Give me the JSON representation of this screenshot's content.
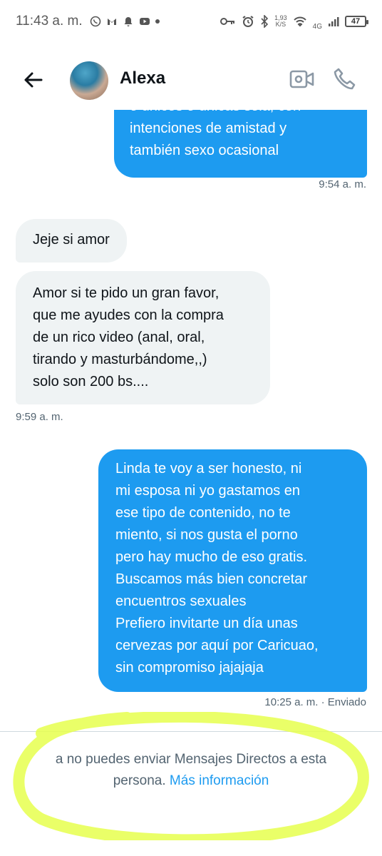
{
  "status_bar": {
    "time": "11:43 a. m.",
    "net_speed_value": "1,93",
    "net_speed_unit": "K/S",
    "network": "4G",
    "battery": "47"
  },
  "header": {
    "contact_name": "Alexa"
  },
  "messages": [
    {
      "direction": "outgoing",
      "lines": [
        "o únicos o únicas sola, con",
        "intenciones de amistad y",
        "también sexo ocasional"
      ]
    },
    {
      "direction": "outgoing-meta",
      "time": "9:54 a. m."
    },
    {
      "direction": "incoming",
      "lines": [
        "Jeje si amor"
      ]
    },
    {
      "direction": "incoming",
      "lines": [
        "Amor si te pido un gran favor,",
        "que me ayudes con la compra",
        "de un rico video (anal, oral,",
        "tirando y masturbándome,,)",
        "solo son 200 bs...."
      ]
    },
    {
      "direction": "incoming-meta",
      "time": "9:59 a. m."
    },
    {
      "direction": "outgoing",
      "lines": [
        "Linda te voy a ser honesto, ni",
        "mi esposa ni yo gastamos en",
        "ese tipo de contenido, no te",
        "miento, si nos gusta el porno",
        "pero hay mucho de eso gratis.",
        "Buscamos más bien concretar",
        "encuentros sexuales",
        "Prefiero invitarte un día unas",
        "cervezas por aquí por Caricuao,",
        "sin compromiso jajajaja"
      ]
    },
    {
      "direction": "outgoing-meta",
      "time": "10:25 a. m. · Enviado"
    }
  ],
  "footer": {
    "line1": "a no puedes enviar Mensajes Directos a esta",
    "line2_prefix": "persona. ",
    "link": "Más información"
  },
  "colors": {
    "accent": "#1d9bf0",
    "incoming_bubble": "#eff3f4",
    "highlight": "#e6ff4d"
  },
  "icons": [
    "whatsapp-icon",
    "gmail-icon",
    "notification-bell-icon",
    "youtube-icon",
    "key-icon",
    "alarm-icon",
    "bluetooth-icon",
    "wifi-icon",
    "signal-icon",
    "battery-icon",
    "back-arrow-icon",
    "video-call-icon",
    "phone-call-icon"
  ]
}
